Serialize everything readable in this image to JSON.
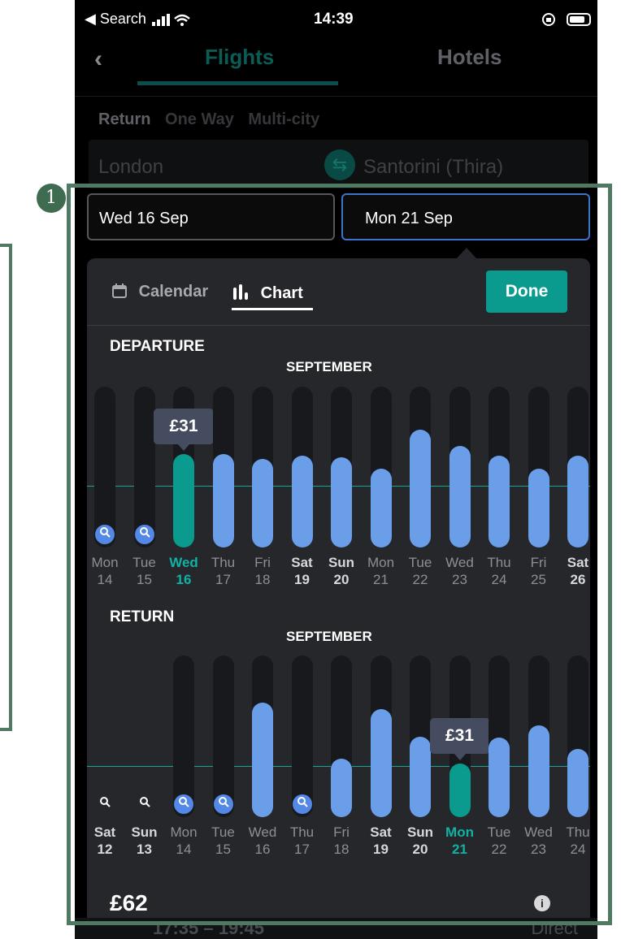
{
  "status_bar": {
    "back_app": "◀ Search",
    "time": "14:39"
  },
  "header": {
    "back_icon": "chevron-left-icon",
    "tabs": [
      "Flights",
      "Hotels"
    ]
  },
  "trip_types": [
    "Return",
    "One Way",
    "Multi-city"
  ],
  "route": {
    "from": "London",
    "to": "Santorini (Thira)"
  },
  "dates": {
    "departure": "Wed 16 Sep",
    "return": "Mon 21 Sep"
  },
  "picker": {
    "tabs": {
      "calendar": "Calendar",
      "chart": "Chart"
    },
    "done_label": "Done",
    "total_price": "£62"
  },
  "departure": {
    "title": "DEPARTURE",
    "month": "SEPTEMBER",
    "selected_price": "£31",
    "days": [
      {
        "dow": "Mon",
        "day": "14",
        "level": null,
        "search": true,
        "weekend": false,
        "selected": false
      },
      {
        "dow": "Tue",
        "day": "15",
        "level": null,
        "search": true,
        "weekend": false,
        "selected": false
      },
      {
        "dow": "Wed",
        "day": "16",
        "level": 0.58,
        "search": false,
        "weekend": false,
        "selected": true
      },
      {
        "dow": "Thu",
        "day": "17",
        "level": 0.58,
        "search": false,
        "weekend": false,
        "selected": false
      },
      {
        "dow": "Fri",
        "day": "18",
        "level": 0.55,
        "search": false,
        "weekend": false,
        "selected": false
      },
      {
        "dow": "Sat",
        "day": "19",
        "level": 0.57,
        "search": false,
        "weekend": true,
        "selected": false
      },
      {
        "dow": "Sun",
        "day": "20",
        "level": 0.56,
        "search": false,
        "weekend": true,
        "selected": false
      },
      {
        "dow": "Mon",
        "day": "21",
        "level": 0.49,
        "search": false,
        "weekend": false,
        "selected": false
      },
      {
        "dow": "Tue",
        "day": "22",
        "level": 0.73,
        "search": false,
        "weekend": false,
        "selected": false
      },
      {
        "dow": "Wed",
        "day": "23",
        "level": 0.63,
        "search": false,
        "weekend": false,
        "selected": false
      },
      {
        "dow": "Thu",
        "day": "24",
        "level": 0.57,
        "search": false,
        "weekend": false,
        "selected": false
      },
      {
        "dow": "Fri",
        "day": "25",
        "level": 0.49,
        "search": false,
        "weekend": false,
        "selected": false
      },
      {
        "dow": "Sat",
        "day": "26",
        "level": 0.57,
        "search": false,
        "weekend": true,
        "selected": false
      }
    ]
  },
  "return": {
    "title": "RETURN",
    "month": "SEPTEMBER",
    "selected_price": "£31",
    "days": [
      {
        "dow": "Sat",
        "day": "12",
        "level": null,
        "search": true,
        "track": false,
        "weekend": true,
        "selected": false
      },
      {
        "dow": "Sun",
        "day": "13",
        "level": null,
        "search": true,
        "track": false,
        "weekend": true,
        "selected": false
      },
      {
        "dow": "Mon",
        "day": "14",
        "level": null,
        "search": true,
        "track": true,
        "weekend": false,
        "selected": false
      },
      {
        "dow": "Tue",
        "day": "15",
        "level": null,
        "search": true,
        "track": true,
        "weekend": false,
        "selected": false
      },
      {
        "dow": "Wed",
        "day": "16",
        "level": 0.71,
        "search": false,
        "track": true,
        "weekend": false,
        "selected": false
      },
      {
        "dow": "Thu",
        "day": "17",
        "level": null,
        "search": true,
        "track": true,
        "weekend": false,
        "selected": false
      },
      {
        "dow": "Fri",
        "day": "18",
        "level": 0.36,
        "search": false,
        "track": true,
        "weekend": false,
        "selected": false
      },
      {
        "dow": "Sat",
        "day": "19",
        "level": 0.67,
        "search": false,
        "track": true,
        "weekend": true,
        "selected": false
      },
      {
        "dow": "Sun",
        "day": "20",
        "level": 0.5,
        "search": false,
        "track": true,
        "weekend": true,
        "selected": false
      },
      {
        "dow": "Mon",
        "day": "21",
        "level": 0.33,
        "search": false,
        "track": true,
        "weekend": false,
        "selected": true
      },
      {
        "dow": "Tue",
        "day": "22",
        "level": 0.49,
        "search": false,
        "track": true,
        "weekend": false,
        "selected": false
      },
      {
        "dow": "Wed",
        "day": "23",
        "level": 0.57,
        "search": false,
        "track": true,
        "weekend": false,
        "selected": false
      },
      {
        "dow": "Thu",
        "day": "24",
        "level": 0.42,
        "search": false,
        "track": true,
        "weekend": false,
        "selected": false
      }
    ]
  },
  "footer_row": {
    "times": "17:35 – 19:45",
    "stops": "Direct"
  },
  "annotation": {
    "badge": "1"
  }
}
